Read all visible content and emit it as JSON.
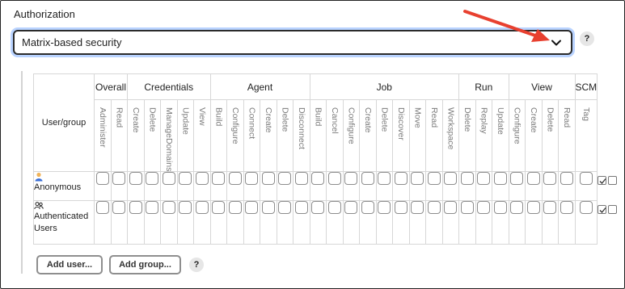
{
  "section_title": "Authorization",
  "strategy_select": {
    "value": "Matrix-based security"
  },
  "help_icon_glyph": "?",
  "matrix": {
    "user_group_header": "User/group",
    "groups": [
      {
        "label": "Overall",
        "perms": [
          "Administer",
          "Read"
        ]
      },
      {
        "label": "Credentials",
        "perms": [
          "Create",
          "Delete",
          "ManageDomains",
          "Update",
          "View"
        ]
      },
      {
        "label": "Agent",
        "perms": [
          "Build",
          "Configure",
          "Connect",
          "Create",
          "Delete",
          "Disconnect"
        ]
      },
      {
        "label": "Job",
        "perms": [
          "Build",
          "Cancel",
          "Configure",
          "Create",
          "Delete",
          "Discover",
          "Move",
          "Read",
          "Workspace"
        ]
      },
      {
        "label": "Run",
        "perms": [
          "Delete",
          "Replay",
          "Update"
        ]
      },
      {
        "label": "View",
        "perms": [
          "Configure",
          "Create",
          "Delete",
          "Read"
        ]
      },
      {
        "label": "SCM",
        "perms": [
          "Tag"
        ]
      }
    ],
    "rows": [
      {
        "name": "Anonymous",
        "icon": "anonymous-user-icon"
      },
      {
        "name": "Authenticated Users",
        "icon": "group-users-icon"
      }
    ]
  },
  "buttons": {
    "add_user": "Add user...",
    "add_group": "Add group..."
  },
  "colors": {
    "focus_ring": "#b9d3ff",
    "arrow": "#e8402f"
  }
}
